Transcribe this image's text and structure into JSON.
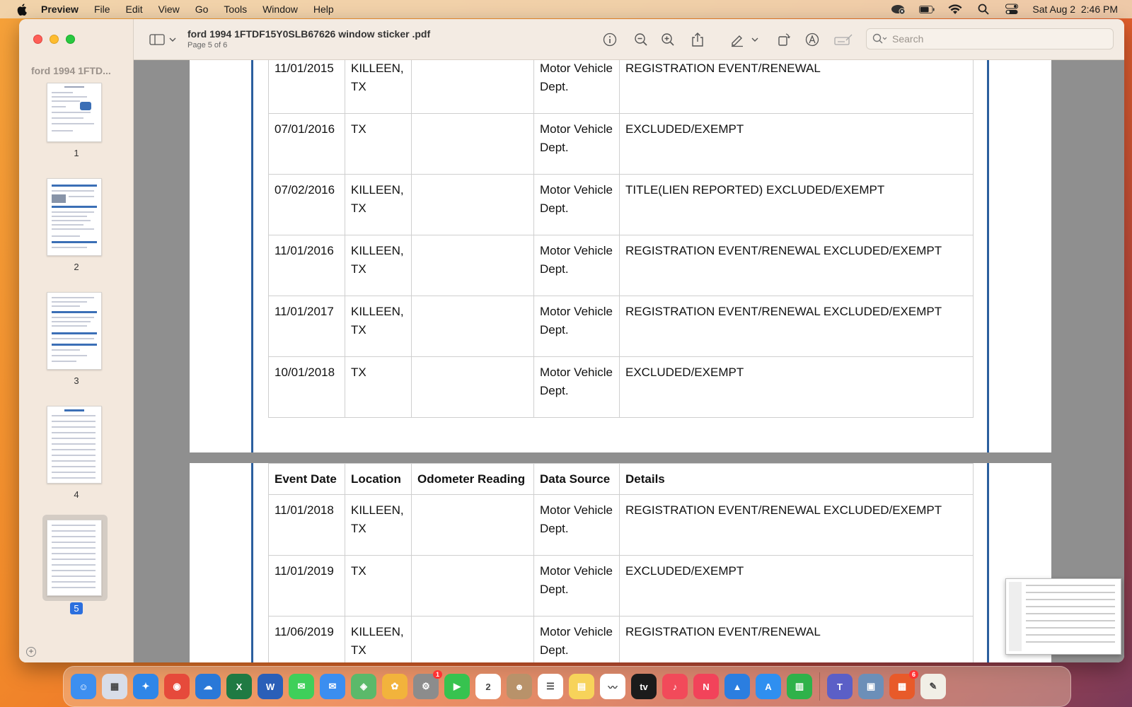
{
  "menubar": {
    "app_name": "Preview",
    "items": [
      "File",
      "Edit",
      "View",
      "Go",
      "Tools",
      "Window",
      "Help"
    ],
    "datetime": "Sat Aug 2  2:46 PM"
  },
  "window": {
    "doc_title": "ford 1994 1FTDF15Y0SLB67626 window sticker .pdf",
    "page_indicator": "Page 5 of 6",
    "search_placeholder": "Search"
  },
  "sidebar": {
    "title": "ford 1994 1FTD...",
    "thumbnails": [
      {
        "label": "1"
      },
      {
        "label": "2"
      },
      {
        "label": "3"
      },
      {
        "label": "4"
      },
      {
        "label": "5",
        "selected": true
      }
    ]
  },
  "table_top": {
    "rows": [
      {
        "date": "11/01/2015",
        "location": "KILLEEN, TX",
        "odometer": "",
        "source": "Motor Vehicle Dept.",
        "details": "REGISTRATION EVENT/RENEWAL"
      },
      {
        "date": "07/01/2016",
        "location": "TX",
        "odometer": "",
        "source": "Motor Vehicle Dept.",
        "details": "EXCLUDED/EXEMPT"
      },
      {
        "date": "07/02/2016",
        "location": "KILLEEN, TX",
        "odometer": "",
        "source": "Motor Vehicle Dept.",
        "details": "TITLE(LIEN REPORTED) EXCLUDED/EXEMPT"
      },
      {
        "date": "11/01/2016",
        "location": "KILLEEN, TX",
        "odometer": "",
        "source": "Motor Vehicle Dept.",
        "details": "REGISTRATION EVENT/RENEWAL EXCLUDED/EXEMPT"
      },
      {
        "date": "11/01/2017",
        "location": "KILLEEN, TX",
        "odometer": "",
        "source": "Motor Vehicle Dept.",
        "details": "REGISTRATION EVENT/RENEWAL EXCLUDED/EXEMPT"
      },
      {
        "date": "10/01/2018",
        "location": "TX",
        "odometer": "",
        "source": "Motor Vehicle Dept.",
        "details": "EXCLUDED/EXEMPT"
      }
    ]
  },
  "table_bottom": {
    "headers": [
      "Event Date",
      "Location",
      "Odometer Reading",
      "Data Source",
      "Details"
    ],
    "rows": [
      {
        "date": "11/01/2018",
        "location": "KILLEEN, TX",
        "odometer": "",
        "source": "Motor Vehicle Dept.",
        "details": "REGISTRATION EVENT/RENEWAL EXCLUDED/EXEMPT"
      },
      {
        "date": "11/01/2019",
        "location": "TX",
        "odometer": "",
        "source": "Motor Vehicle Dept.",
        "details": "EXCLUDED/EXEMPT"
      },
      {
        "date": "11/06/2019",
        "location": "KILLEEN, TX",
        "odometer": "",
        "source": "Motor Vehicle Dept.",
        "details": "REGISTRATION EVENT/RENEWAL"
      }
    ]
  },
  "dock": {
    "apps": [
      {
        "name": "finder",
        "color": "#3d8ff0",
        "glyph": "☺"
      },
      {
        "name": "launchpad",
        "color": "#d8dde8",
        "glyph": "▦"
      },
      {
        "name": "safari",
        "color": "#2f86e8",
        "glyph": "✦"
      },
      {
        "name": "chrome",
        "color": "#e64a3b",
        "glyph": "◉"
      },
      {
        "name": "onedrive",
        "color": "#2a78d8",
        "glyph": "☁"
      },
      {
        "name": "excel",
        "color": "#1f7a43",
        "glyph": "X"
      },
      {
        "name": "word",
        "color": "#2a5fb8",
        "glyph": "W"
      },
      {
        "name": "messages",
        "color": "#3fcf5a",
        "glyph": "✉"
      },
      {
        "name": "mail",
        "color": "#3b8ef0",
        "glyph": "✉"
      },
      {
        "name": "maps",
        "color": "#5bb96a",
        "glyph": "◈"
      },
      {
        "name": "photos",
        "color": "#f2b33c",
        "glyph": "✿"
      },
      {
        "name": "settings",
        "color": "#8c8c8c",
        "glyph": "⚙",
        "badge": "1"
      },
      {
        "name": "facetime",
        "color": "#37c34f",
        "glyph": "▶"
      },
      {
        "name": "calendar",
        "color": "#ffffff",
        "glyph": "2"
      },
      {
        "name": "contacts",
        "color": "#b8926a",
        "glyph": "☻"
      },
      {
        "name": "reminders",
        "color": "#ffffff",
        "glyph": "☰"
      },
      {
        "name": "notes",
        "color": "#f7d35a",
        "glyph": "▤"
      },
      {
        "name": "freeform",
        "color": "#ffffff",
        "glyph": "〰"
      },
      {
        "name": "tv",
        "color": "#1b1b1b",
        "glyph": "tv"
      },
      {
        "name": "music",
        "color": "#f24a5a",
        "glyph": "♪"
      },
      {
        "name": "news",
        "color": "#f2435a",
        "glyph": "N"
      },
      {
        "name": "keynote",
        "color": "#2b7ee0",
        "glyph": "▲"
      },
      {
        "name": "app-store",
        "color": "#2f8ff0",
        "glyph": "A"
      },
      {
        "name": "numbers",
        "color": "#2fb24a",
        "glyph": "▥"
      },
      {
        "name": "teams",
        "color": "#5b5fc7",
        "glyph": "T"
      },
      {
        "name": "preview",
        "color": "#6c8fb8",
        "glyph": "▣"
      },
      {
        "name": "microsoft-office",
        "color": "#e85a2a",
        "glyph": "▩",
        "badge": "6"
      },
      {
        "name": "textedit",
        "color": "#f1efe6",
        "glyph": "✎"
      }
    ]
  }
}
